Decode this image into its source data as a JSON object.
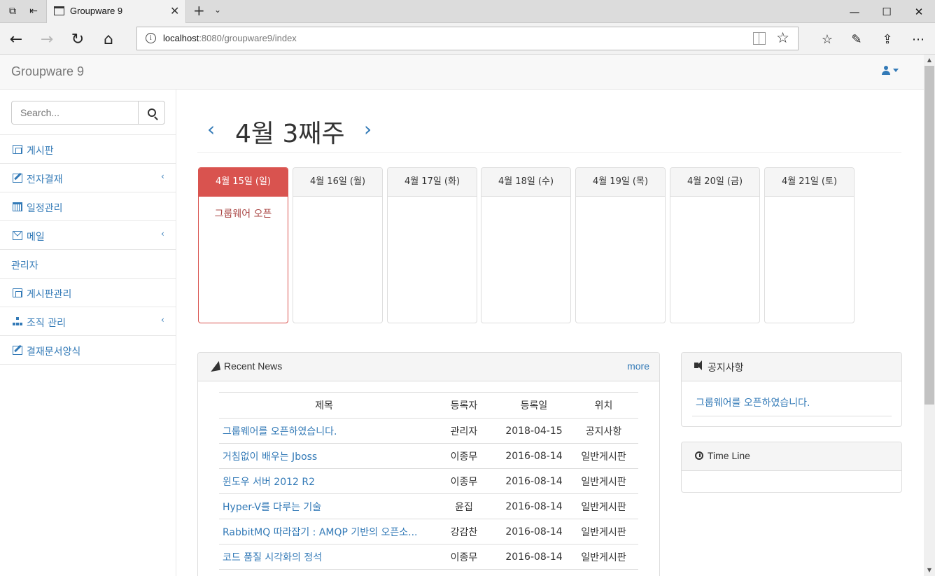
{
  "browser": {
    "tab_title": "Groupware 9",
    "url_host": "localhost",
    "url_path": ":8080/groupware9/index"
  },
  "app": {
    "brand": "Groupware 9"
  },
  "sidebar": {
    "search_placeholder": "Search...",
    "items": [
      {
        "label": "게시판",
        "icon": "copy-icon",
        "has_submenu": false
      },
      {
        "label": "전자결재",
        "icon": "edit-icon",
        "has_submenu": true
      },
      {
        "label": "일정관리",
        "icon": "calendar-icon",
        "has_submenu": false
      },
      {
        "label": "메일",
        "icon": "mail-icon",
        "has_submenu": true
      },
      {
        "label": "관리자",
        "icon": "",
        "has_submenu": false
      },
      {
        "label": "게시판관리",
        "icon": "copy-icon",
        "has_submenu": false
      },
      {
        "label": "조직 관리",
        "icon": "sitemap-icon",
        "has_submenu": true
      },
      {
        "label": "결재문서양식",
        "icon": "edit-icon",
        "has_submenu": false
      }
    ]
  },
  "calendar": {
    "week_title": "4월 3째주",
    "prev": "‹",
    "next": "›",
    "days": [
      {
        "label": "4월 15일 (일)",
        "today": true,
        "events": [
          "그룹웨어 오픈"
        ]
      },
      {
        "label": "4월 16일 (월)",
        "today": false,
        "events": []
      },
      {
        "label": "4월 17일 (화)",
        "today": false,
        "events": []
      },
      {
        "label": "4월 18일 (수)",
        "today": false,
        "events": []
      },
      {
        "label": "4월 19일 (목)",
        "today": false,
        "events": []
      },
      {
        "label": "4월 20일 (금)",
        "today": false,
        "events": []
      },
      {
        "label": "4월 21일 (토)",
        "today": false,
        "events": []
      }
    ]
  },
  "news": {
    "title": "Recent News",
    "more": "more",
    "columns": [
      "제목",
      "등록자",
      "등록일",
      "위치"
    ],
    "rows": [
      [
        "그룹웨어를 오픈하였습니다.",
        "관리자",
        "2018-04-15",
        "공지사항"
      ],
      [
        "거침없이 배우는 Jboss",
        "이종무",
        "2016-08-14",
        "일반게시판"
      ],
      [
        "윈도우 서버 2012 R2",
        "이종무",
        "2016-08-14",
        "일반게시판"
      ],
      [
        "Hyper-V를 다루는 기술",
        "윤집",
        "2016-08-14",
        "일반게시판"
      ],
      [
        "RabbitMQ 따라잡기 : AMQP 기반의 오픈소...",
        "강감찬",
        "2016-08-14",
        "일반게시판"
      ],
      [
        "코드 품질 시각화의 정석",
        "이종무",
        "2016-08-14",
        "일반게시판"
      ]
    ]
  },
  "notice": {
    "title": "공지사항",
    "items": [
      "그룹웨어를 오픈하였습니다."
    ]
  },
  "timeline": {
    "title": "Time Line"
  },
  "colors": {
    "link": "#337ab7",
    "today": "#d9534f",
    "event": "#a94442"
  }
}
